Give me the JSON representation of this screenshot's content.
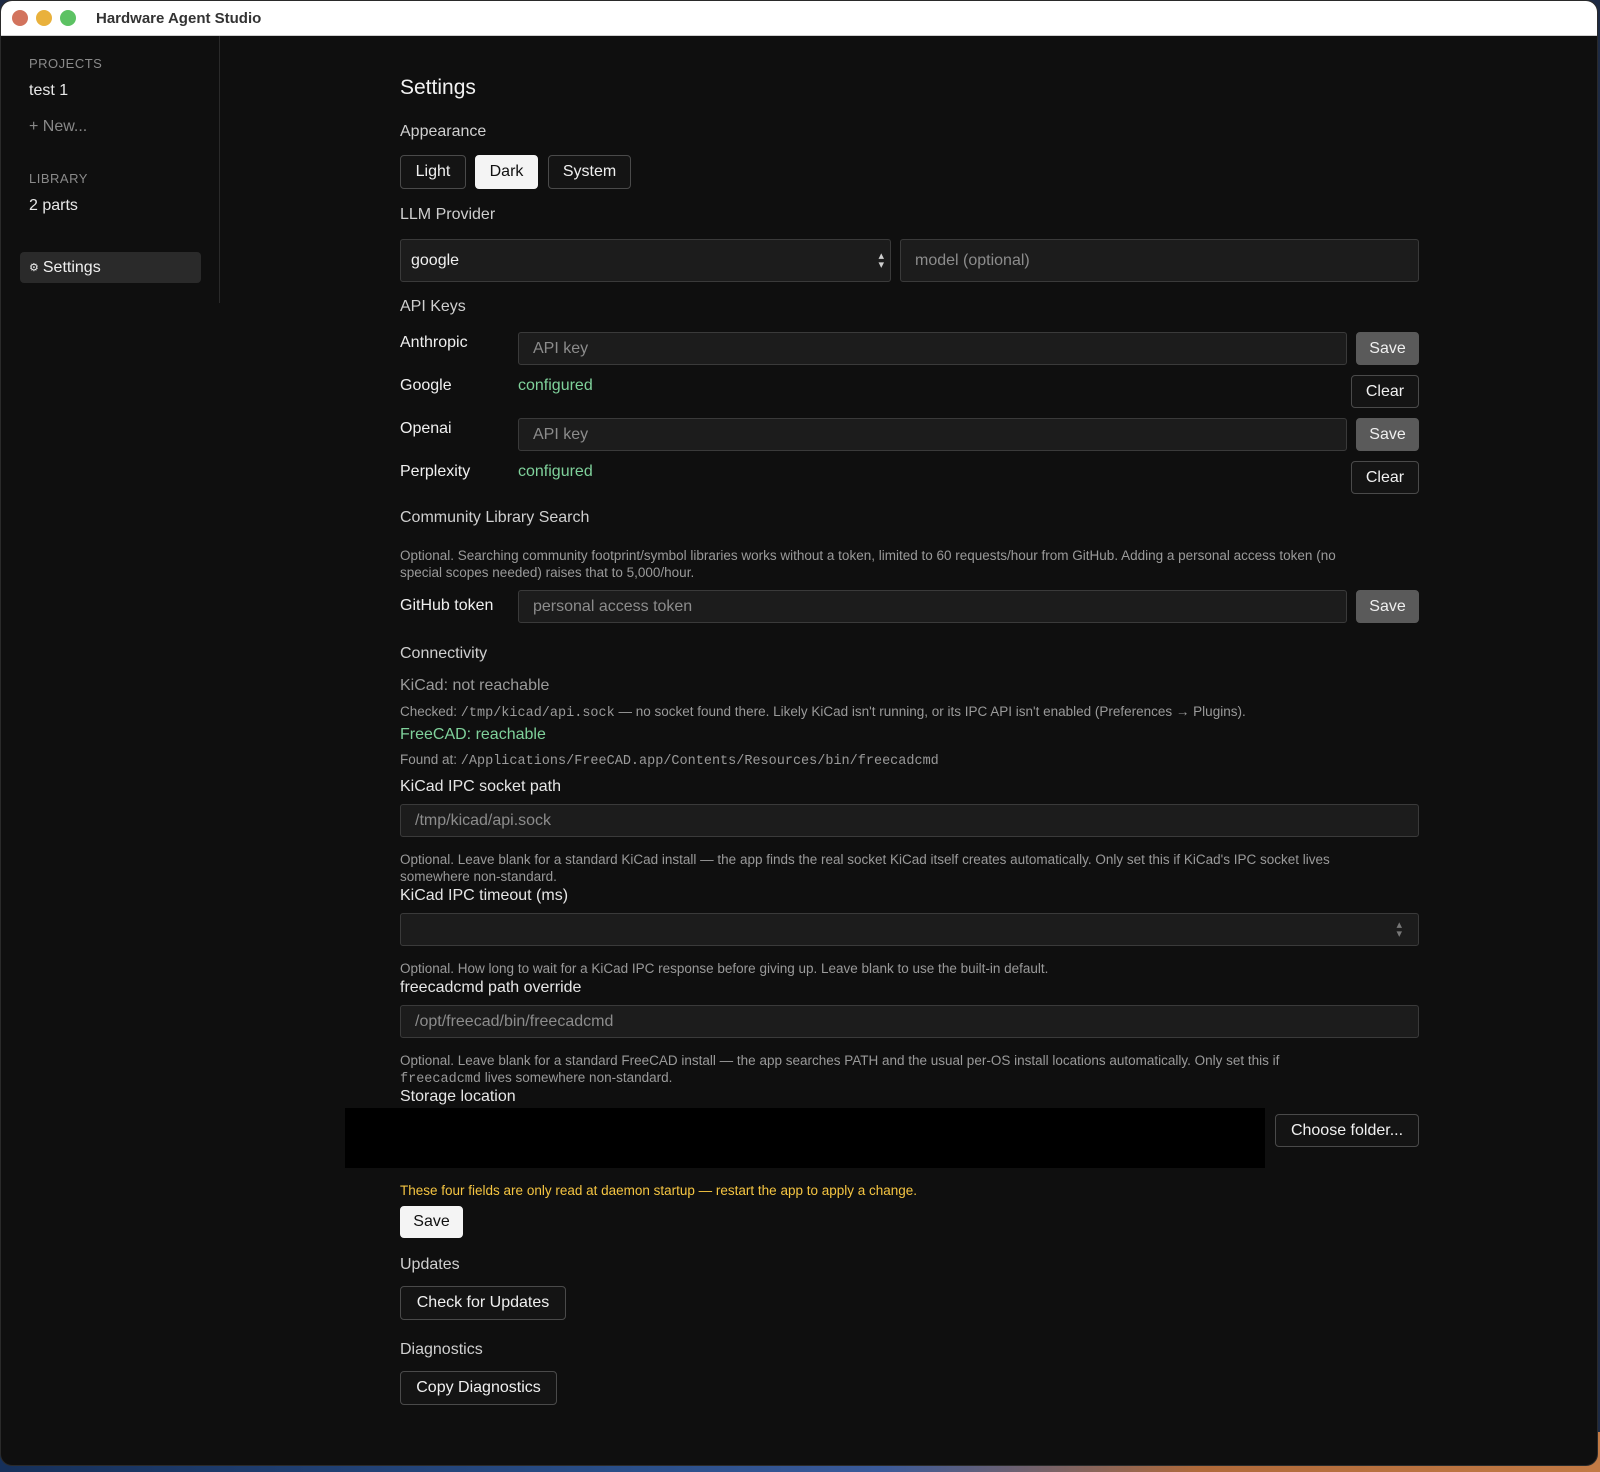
{
  "window": {
    "title": "Hardware Agent Studio"
  },
  "sidebar": {
    "projects_heading": "PROJECTS",
    "project_item": "test 1",
    "new_label": "+ New...",
    "library_heading": "LIBRARY",
    "library_item": "2 parts",
    "settings_label": "Settings",
    "settings_icon": "gear-icon"
  },
  "settings": {
    "title": "Settings",
    "appearance": {
      "heading": "Appearance",
      "options": [
        "Light",
        "Dark",
        "System"
      ],
      "selected": "Dark"
    },
    "llm": {
      "heading": "LLM Provider",
      "provider_value": "google",
      "model_placeholder": "model (optional)"
    },
    "api_keys": {
      "heading": "API Keys",
      "anthropic": {
        "label": "Anthropic",
        "placeholder": "API key",
        "button": "Save"
      },
      "google": {
        "label": "Google",
        "status": "configured",
        "button": "Clear"
      },
      "openai": {
        "label": "Openai",
        "placeholder": "API key",
        "button": "Save"
      },
      "perplexity": {
        "label": "Perplexity",
        "status": "configured",
        "button": "Clear"
      }
    },
    "community": {
      "heading": "Community Library Search",
      "help_line1": "Optional. Searching community footprint/symbol libraries works without a token, limited to 60 requests/hour from GitHub. Adding a personal access token (no",
      "help_line2": "special scopes needed) raises that to 5,000/hour.",
      "token_label": "GitHub token",
      "token_placeholder": "personal access token",
      "button": "Save"
    },
    "connectivity": {
      "heading": "Connectivity",
      "kicad_status": "KiCad: not reachable",
      "kicad_checked_prefix": "Checked: ",
      "kicad_checked_path": "/tmp/kicad/api.sock",
      "kicad_checked_suffix": " — no socket found there. Likely KiCad isn't running, or its IPC API isn't enabled (Preferences → Plugins).",
      "freecad_status": "FreeCAD: reachable",
      "freecad_found_prefix": "Found at: ",
      "freecad_found_path": "/Applications/FreeCAD.app/Contents/Resources/bin/freecadcmd"
    },
    "kicad_socket": {
      "label": "KiCad IPC socket path",
      "placeholder": "/tmp/kicad/api.sock",
      "help_line1": "Optional. Leave blank for a standard KiCad install — the app finds the real socket KiCad itself creates automatically. Only set this if KiCad's IPC socket lives",
      "help_line2": "somewhere non-standard."
    },
    "kicad_timeout": {
      "label": "KiCad IPC timeout (ms)",
      "value": "",
      "help": "Optional. How long to wait for a KiCad IPC response before giving up. Leave blank to use the built-in default."
    },
    "freecad_override": {
      "label": "freecadcmd path override",
      "placeholder": "/opt/freecad/bin/freecadcmd",
      "help_line1": "Optional. Leave blank for a standard FreeCAD install — the app searches PATH and the usual per-OS install locations automatically. Only set this if",
      "help_line2_code": "freecadcmd",
      "help_line2_rest": " lives somewhere non-standard."
    },
    "storage": {
      "label": "Storage location",
      "button": "Choose folder..."
    },
    "restart_warning": "These four fields are only read at daemon startup — restart the app to apply a change.",
    "save_button": "Save",
    "updates": {
      "heading": "Updates",
      "button": "Check for Updates"
    },
    "diagnostics": {
      "heading": "Diagnostics",
      "button": "Copy Diagnostics"
    }
  }
}
